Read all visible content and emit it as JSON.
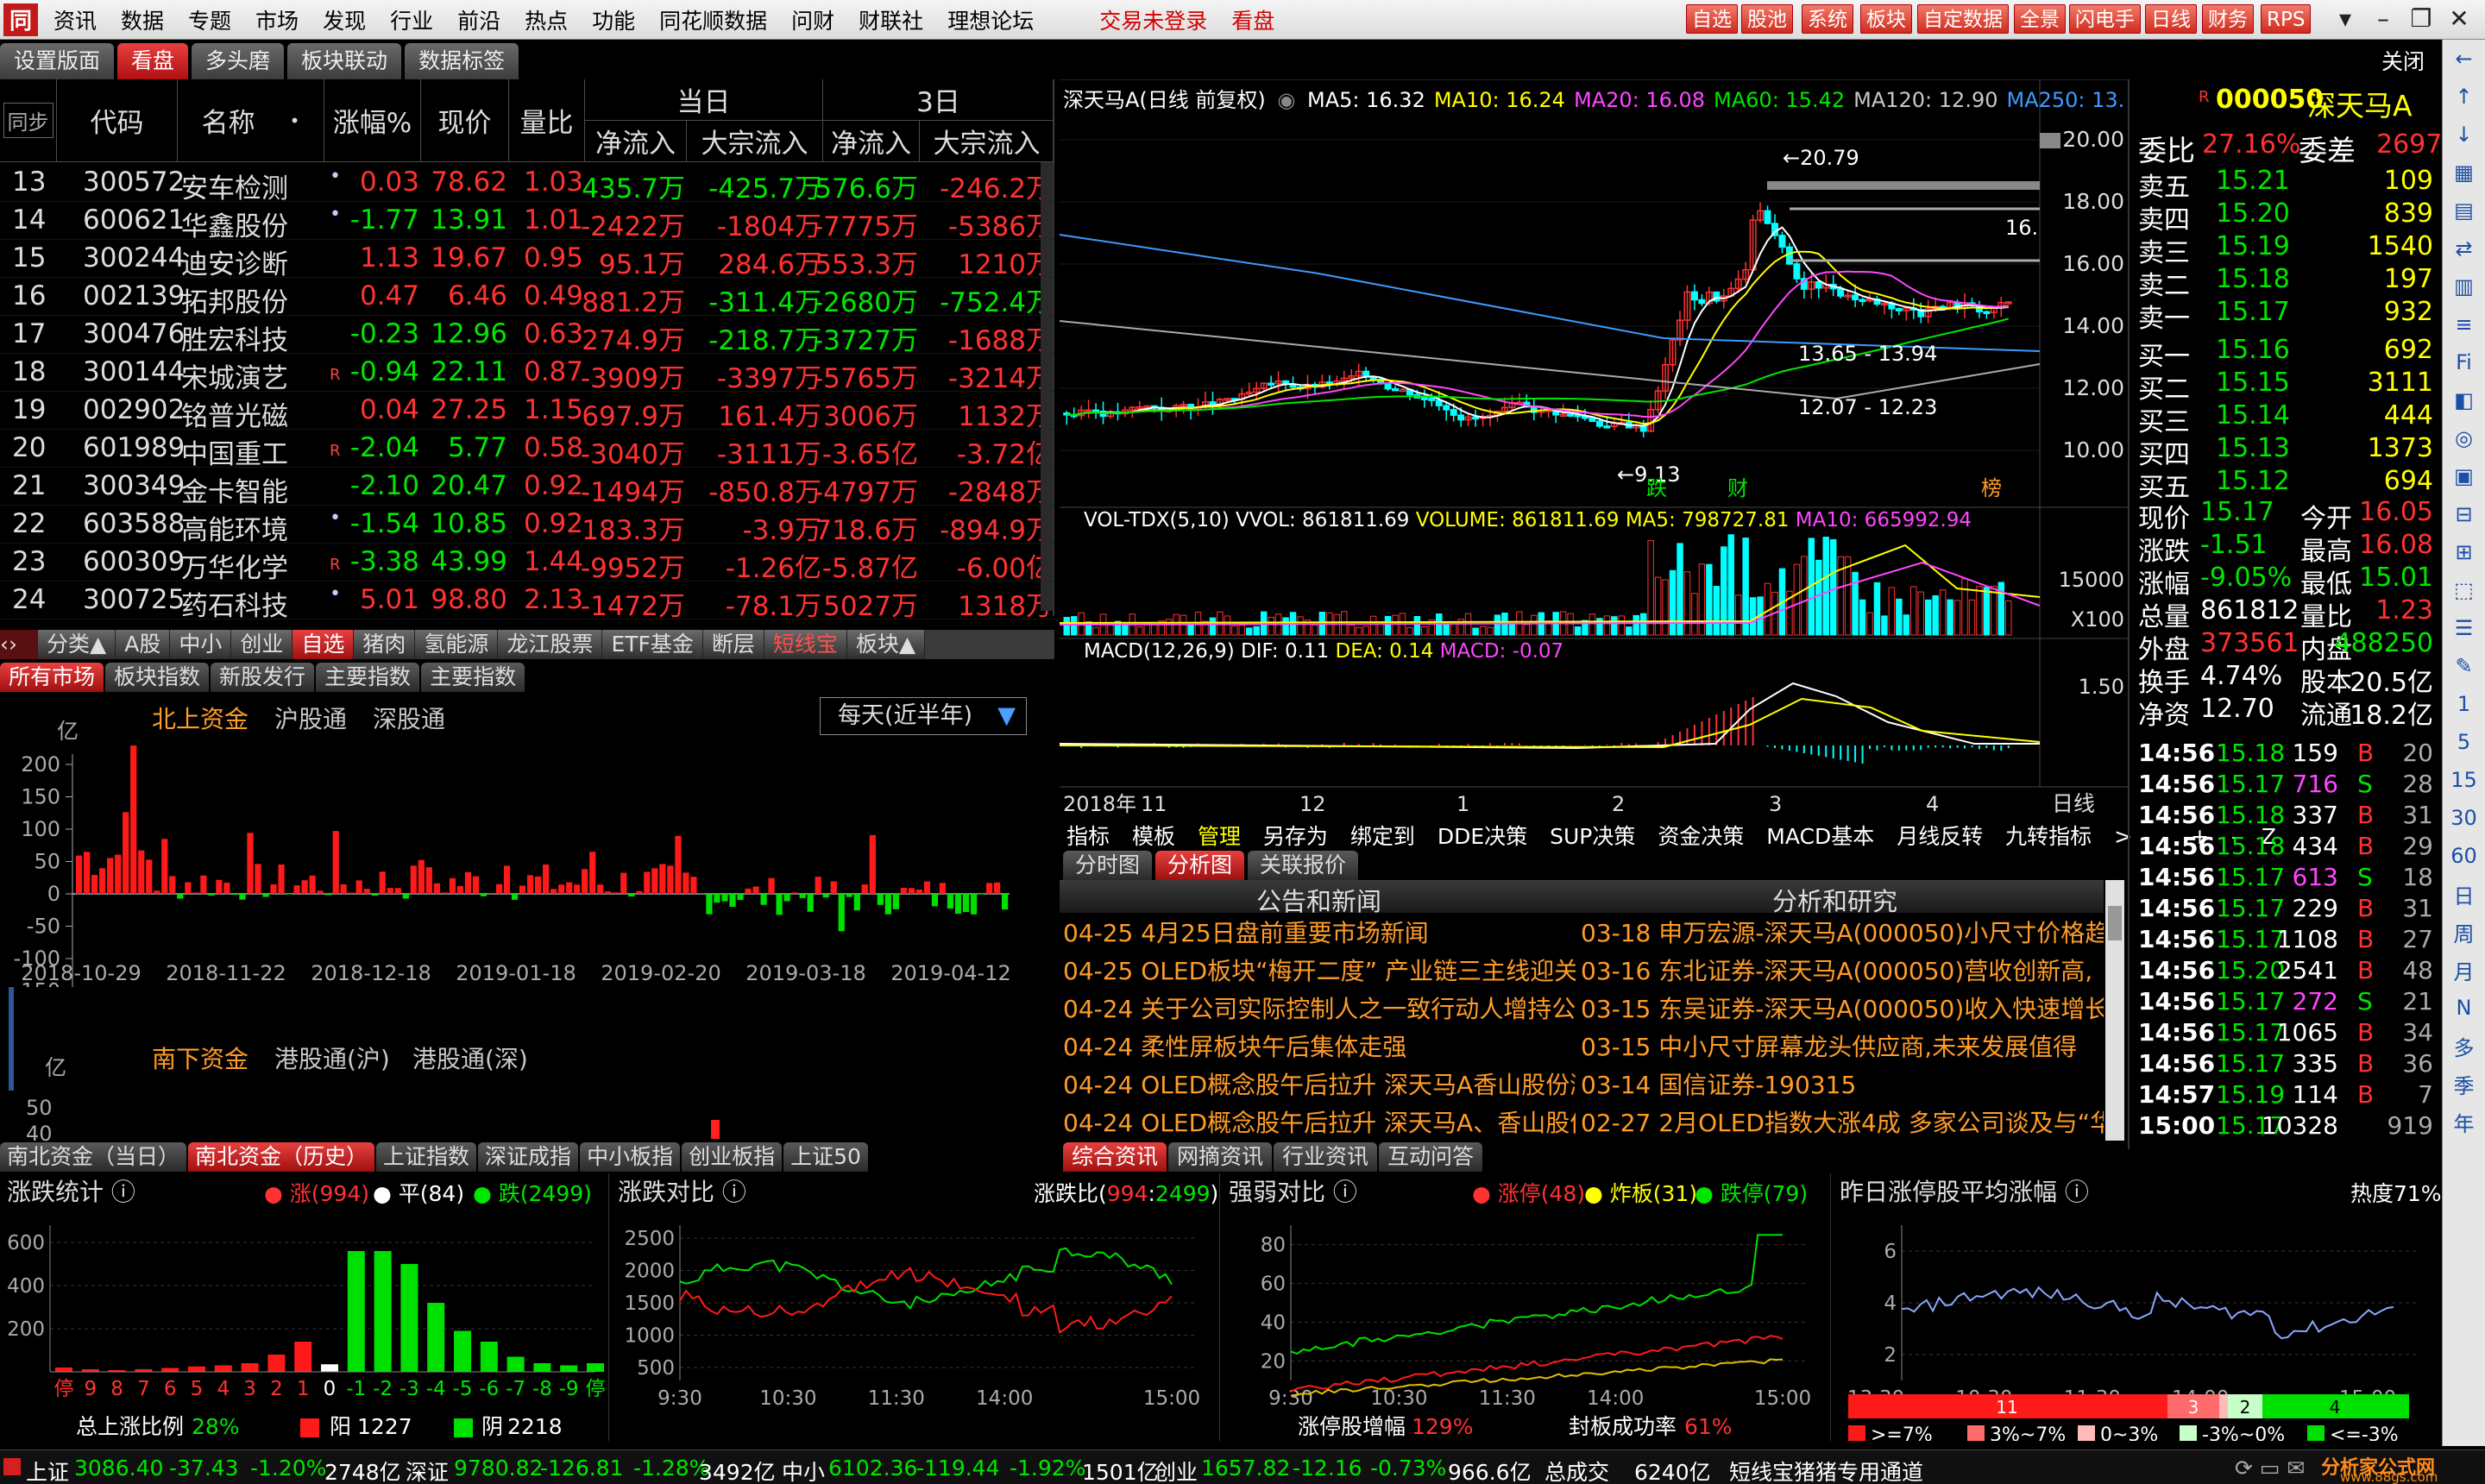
{
  "menubar": {
    "logo": "同",
    "items": [
      "资讯",
      "数据",
      "专题",
      "市场",
      "发现",
      "行业",
      "前沿",
      "热点",
      "功能",
      "同花顺数据",
      "问财",
      "财联社",
      "理想论坛"
    ],
    "login": "交易未登录",
    "kanpan": "看盘",
    "toolbuttons": [
      "自选",
      "股池",
      "系统",
      "板块",
      "自定数据",
      "全景",
      "闪电手",
      "日线",
      "财务",
      "RPS"
    ]
  },
  "tabs": [
    "设置版面",
    "看盘",
    "多头磨",
    "板块联动",
    "数据标签"
  ],
  "close": "关闭",
  "sidebar_icons": [
    "←",
    "↑",
    "↓",
    "▦",
    "▤",
    "⇄",
    "▥",
    "≡",
    "Fi",
    "◧",
    "◎",
    "▣",
    "⊟",
    "⊞",
    "⬚",
    "☰",
    "✎",
    "1",
    "5",
    "15",
    "30",
    "60",
    "日",
    "周",
    "月",
    "N",
    "多",
    "季",
    "年"
  ],
  "grid": {
    "headers": {
      "sync": "同步",
      "code": "代码",
      "name": "名称",
      "dot": "•",
      "pct": "涨幅%",
      "price": "现价",
      "lb": "量比",
      "today": "当日",
      "three": "3日",
      "inflow": "净流入",
      "bulk": "大宗流入",
      "inflow3": "净流入",
      "bulk3": "大宗流入"
    },
    "rows": [
      {
        "n": "13",
        "code": "300572",
        "name": "安车检测",
        "m": "•",
        "pct": "0.03",
        "price": "78.62",
        "lb": "1.03",
        "in": "435.7万",
        "bulk": "-425.7万",
        "in3": "576.6万",
        "bulk3": "-246.2万",
        "pr": "r",
        "ir": "g",
        "br": "g",
        "i3": "g",
        "b3": "r"
      },
      {
        "n": "14",
        "code": "600621",
        "name": "华鑫股份",
        "m": "•",
        "pct": "-1.77",
        "price": "13.91",
        "lb": "1.01",
        "in": "-2422万",
        "bulk": "-1804万",
        "in3": "-7775万",
        "bulk3": "-5386万",
        "pr": "g",
        "ir": "r",
        "br": "r",
        "i3": "r",
        "b3": "r"
      },
      {
        "n": "15",
        "code": "300244",
        "name": "迪安诊断",
        "m": "",
        "pct": "1.13",
        "price": "19.67",
        "lb": "0.95",
        "in": "95.1万",
        "bulk": "284.6万",
        "in3": "553.3万",
        "bulk3": "1210万",
        "pr": "r",
        "ir": "r",
        "br": "r",
        "i3": "r",
        "b3": "r"
      },
      {
        "n": "16",
        "code": "002139",
        "name": "拓邦股份",
        "m": "",
        "pct": "0.47",
        "price": "6.46",
        "lb": "0.49",
        "in": "881.2万",
        "bulk": "-311.4万",
        "in3": "-2680万",
        "bulk3": "-752.4万",
        "pr": "r",
        "ir": "r",
        "br": "g",
        "i3": "g",
        "b3": "g"
      },
      {
        "n": "17",
        "code": "300476",
        "name": "胜宏科技",
        "m": "",
        "pct": "-0.23",
        "price": "12.96",
        "lb": "0.63",
        "in": "274.9万",
        "bulk": "-218.7万",
        "in3": "-3727万",
        "bulk3": "-1688万",
        "pr": "g",
        "ir": "r",
        "br": "g",
        "i3": "g",
        "b3": "r"
      },
      {
        "n": "18",
        "code": "300144",
        "name": "宋城演艺",
        "m": "R",
        "pct": "-0.94",
        "price": "22.11",
        "lb": "0.87",
        "in": "-3909万",
        "bulk": "-3397万",
        "in3": "-5765万",
        "bulk3": "-3214万",
        "pr": "g",
        "ir": "r",
        "br": "r",
        "i3": "r",
        "b3": "r"
      },
      {
        "n": "19",
        "code": "002902",
        "name": "铭普光磁",
        "m": "",
        "pct": "0.04",
        "price": "27.25",
        "lb": "1.15",
        "in": "697.9万",
        "bulk": "161.4万",
        "in3": "3006万",
        "bulk3": "1132万",
        "pr": "r",
        "ir": "r",
        "br": "r",
        "i3": "r",
        "b3": "r"
      },
      {
        "n": "20",
        "code": "601989",
        "name": "中国重工",
        "m": "R",
        "pct": "-2.04",
        "price": "5.77",
        "lb": "0.58",
        "in": "-3040万",
        "bulk": "-3111万",
        "in3": "-3.65亿",
        "bulk3": "-3.72亿",
        "pr": "g",
        "ir": "r",
        "br": "r",
        "i3": "r",
        "b3": "r"
      },
      {
        "n": "21",
        "code": "300349",
        "name": "金卡智能",
        "m": "",
        "pct": "-2.10",
        "price": "20.47",
        "lb": "0.92",
        "in": "-1494万",
        "bulk": "-850.8万",
        "in3": "-4797万",
        "bulk3": "-2848万",
        "pr": "g",
        "ir": "r",
        "br": "r",
        "i3": "r",
        "b3": "r"
      },
      {
        "n": "22",
        "code": "603588",
        "name": "高能环境",
        "m": "•",
        "pct": "-1.54",
        "price": "10.85",
        "lb": "0.92",
        "in": "183.3万",
        "bulk": "-3.9万",
        "in3": "718.6万",
        "bulk3": "-894.9万",
        "pr": "g",
        "ir": "r",
        "br": "r",
        "i3": "r",
        "b3": "r"
      },
      {
        "n": "23",
        "code": "600309",
        "name": "万华化学",
        "m": "R",
        "pct": "-3.38",
        "price": "43.99",
        "lb": "1.44",
        "in": "-9952万",
        "bulk": "-1.26亿",
        "in3": "-5.87亿",
        "bulk3": "-6.00亿",
        "pr": "g",
        "ir": "r",
        "br": "r",
        "i3": "r",
        "b3": "r"
      },
      {
        "n": "24",
        "code": "300725",
        "name": "药石科技",
        "m": "•",
        "pct": "5.01",
        "price": "98.80",
        "lb": "2.13",
        "in": "-1472万",
        "bulk": "-78.1万",
        "in3": "5027万",
        "bulk3": "1318万",
        "pr": "r",
        "ir": "r",
        "br": "r",
        "i3": "r",
        "b3": "r"
      }
    ]
  },
  "cat1": [
    "分类▲",
    "A股",
    "中小",
    "创业",
    "自选",
    "猪肉",
    "氢能源",
    "龙江股票",
    "ETF基金",
    "断层",
    "短线宝",
    "板块▲"
  ],
  "cat2": [
    "所有市场",
    "板块指数",
    "新股发行",
    "主要指数",
    "主要指数"
  ],
  "northbound": {
    "unit": "亿",
    "tabs": [
      "北上资金",
      "沪股通",
      "深股通"
    ],
    "select": "每天(近半年)",
    "yticks": [
      "200",
      "150",
      "100",
      "50",
      "0",
      "-50",
      "-100",
      "-150"
    ],
    "dates": [
      "2018-10-29",
      "2018-11-22",
      "2018-12-18",
      "2019-01-18",
      "2019-02-20",
      "2019-03-18",
      "2019-04-12"
    ],
    "south_unit": "亿",
    "south_tabs": [
      "南下资金",
      "港股通(沪)",
      "港股通(深)"
    ],
    "south_ticks": [
      "50",
      "40"
    ]
  },
  "bar2": [
    "南北资金（当日）",
    "南北资金（历史）",
    "上证指数",
    "深证成指",
    "中小板指",
    "创业板指",
    "上证50"
  ],
  "kline": {
    "name": "深天马A",
    "period": "(日线 前复权)",
    "ma": [
      {
        "t": "MA5: 16.32",
        "c": "#ffffff"
      },
      {
        "t": "MA10: 16.24",
        "c": "#ffff00"
      },
      {
        "t": "MA20: 16.08",
        "c": "#ff46ff"
      },
      {
        "t": "MA60: 15.42",
        "c": "#00e600"
      },
      {
        "t": "MA120: 12.90",
        "c": "#c8c8c8"
      },
      {
        "t": "MA250: 13.",
        "c": "#3c9cff"
      }
    ],
    "yticks": [
      "20.00",
      "18.00",
      "16.00",
      "14.00",
      "12.00",
      "10.00"
    ],
    "high": "20.79",
    "low": "9.13",
    "range1": "13.65 - 13.94",
    "range2": "12.07 - 12.23",
    "side": "16.",
    "markers": [
      "跌",
      "财",
      "榜"
    ],
    "vol_title": "VOL-TDX(5,10)  VVOL: 861811.69",
    "vol_vals": [
      {
        "t": "VOLUME: 861811.69",
        "c": "#ffff00"
      },
      {
        "t": "MA5: 798727.81",
        "c": "#ffff00"
      },
      {
        "t": "MA10: 665992.94",
        "c": "#ff46ff"
      }
    ],
    "vol_tick": "15000",
    "vol_mult": "X100",
    "macd_title": "MACD(12,26,9)  DIF: 0.11",
    "macd_vals": [
      {
        "t": "DEA: 0.14",
        "c": "#ffff00"
      },
      {
        "t": "MACD: -0.07",
        "c": "#ff46ff"
      }
    ],
    "macd_tick": "1.50",
    "xlabels": [
      "2018年",
      "11",
      "12",
      "1",
      "2",
      "3",
      "4"
    ],
    "period_label": "日线"
  },
  "ctools": [
    "指标",
    "模板",
    "管理",
    "另存为",
    "绑定到",
    "DDE决策",
    "SUP决策",
    "资金决策",
    "MACD基本",
    "月线反转",
    "九转指标",
    ">",
    "+",
    "-",
    "Z"
  ],
  "atabs": [
    "分时图",
    "分析图",
    "关联报价"
  ],
  "news": {
    "h1": "公告和新闻",
    "h2": "分析和研究",
    "left": [
      [
        "04-25",
        "4月25日盘前重要市场新闻"
      ],
      [
        "04-25",
        "OLED板块“梅开二度” 产业链三主线迎关"
      ],
      [
        "04-24",
        "关于公司实际控制人之一致行动人增持公"
      ],
      [
        "04-24",
        "柔性屏板块午后集体走强"
      ],
      [
        "04-24",
        "OLED概念股午后拉升 深天马A香山股份涨"
      ],
      [
        "04-24",
        "OLED概念股午后拉升 深天马A、香山股份"
      ]
    ],
    "right": [
      [
        "03-18",
        "申万宏源-深天马A(000050)小尺寸价格趋"
      ],
      [
        "03-16",
        "东北证券-深天马A(000050)营收创新高,"
      ],
      [
        "03-15",
        "东吴证券-深天马A(000050)收入快速增长"
      ],
      [
        "03-15",
        "中小尺寸屏幕龙头供应商,未来发展值得"
      ],
      [
        "03-14",
        "国信证券-190315"
      ],
      [
        "02-27",
        "2月OLED指数大涨4成 多家公司谈及与“华"
      ]
    ]
  },
  "bar3": [
    "综合资讯",
    "网摘资讯",
    "行业资讯",
    "互动问答"
  ],
  "quote": {
    "r": "R",
    "code": "000050",
    "name": "深天马A",
    "wb": "委比",
    "wbv": "27.16%",
    "wc": "委差",
    "wcv": "2697",
    "asks": [
      [
        "卖五",
        "15.21",
        "109"
      ],
      [
        "卖四",
        "15.20",
        "839"
      ],
      [
        "卖三",
        "15.19",
        "1540"
      ],
      [
        "卖二",
        "15.18",
        "197"
      ],
      [
        "卖一",
        "15.17",
        "932"
      ]
    ],
    "bids": [
      [
        "买一",
        "15.16",
        "692"
      ],
      [
        "买二",
        "15.15",
        "3111"
      ],
      [
        "买三",
        "15.14",
        "444"
      ],
      [
        "买四",
        "15.13",
        "1373"
      ],
      [
        "买五",
        "15.12",
        "694"
      ]
    ],
    "stats": [
      [
        "现价",
        "15.17",
        "今开",
        "16.05"
      ],
      [
        "涨跌",
        "-1.51",
        "最高",
        "16.08"
      ],
      [
        "涨幅",
        "-9.05%",
        "最低",
        "15.01"
      ],
      [
        "总量",
        "861812",
        "量比",
        "1.23"
      ],
      [
        "外盘",
        "373561",
        "内盘",
        "488250"
      ],
      [
        "换手",
        "4.74%",
        "股本",
        "20.5亿"
      ],
      [
        "净资",
        "12.70",
        "流通",
        "18.2亿"
      ]
    ],
    "ticks": [
      [
        "14:56",
        "15.18",
        "159",
        "B",
        "20"
      ],
      [
        "14:56",
        "15.17",
        "716",
        "S",
        "28"
      ],
      [
        "14:56",
        "15.18",
        "337",
        "B",
        "31"
      ],
      [
        "14:56",
        "15.18",
        "434",
        "B",
        "29"
      ],
      [
        "14:56",
        "15.17",
        "613",
        "S",
        "18"
      ],
      [
        "14:56",
        "15.17",
        "229",
        "B",
        "31"
      ],
      [
        "14:56",
        "15.17",
        "1108",
        "B",
        "27"
      ],
      [
        "14:56",
        "15.20",
        "2541",
        "B",
        "48"
      ],
      [
        "14:56",
        "15.17",
        "272",
        "S",
        "21"
      ],
      [
        "14:56",
        "15.17",
        "1065",
        "B",
        "34"
      ],
      [
        "14:56",
        "15.17",
        "335",
        "B",
        "36"
      ],
      [
        "14:57",
        "15.19",
        "114",
        "B",
        "7"
      ],
      [
        "15:00",
        "15.17",
        "10328",
        "",
        "919"
      ]
    ]
  },
  "zdtj": {
    "title": "涨跌统计",
    "up": "涨(994)",
    "flat": "平(84)",
    "down": "跌(2499)",
    "yticks": [
      "600",
      "400",
      "200"
    ],
    "xl": [
      "停",
      "9",
      "8",
      "7",
      "6",
      "5",
      "4",
      "3",
      "2",
      "1",
      "0",
      "-1",
      "-2",
      "-3",
      "-4",
      "-5",
      "-6",
      "-7",
      "-8",
      "-9",
      "停"
    ],
    "ratio_label": "总上涨比例",
    "ratio": "28%",
    "yang_label": "阳",
    "yang": "1227",
    "yin_label": "阴",
    "yin": "2218"
  },
  "zdbi": {
    "title": "涨跌对比",
    "label": "涨跌比(",
    "up": "994",
    "sep": ":",
    "down": "2499",
    "end": ")",
    "yticks": [
      "2500",
      "2000",
      "1500",
      "1000",
      "500"
    ],
    "xt": [
      "9:30",
      "10:30",
      "11:30",
      "14:00",
      "15:00"
    ]
  },
  "qrdb": {
    "title": "强弱对比",
    "zt": "涨停(48)",
    "zb": "炸板(31)",
    "dt": "跌停(79)",
    "yticks": [
      "80",
      "60",
      "40",
      "20"
    ],
    "xt": [
      "9:30",
      "10:30",
      "11:30",
      "14:00",
      "15:00"
    ],
    "l1": "涨停股增幅",
    "v1": "129%",
    "l2": "封板成功率",
    "v2": "61%"
  },
  "zrzt": {
    "title": "昨日涨停股平均涨幅",
    "heat": "热度71%",
    "yticks": [
      "6",
      "4",
      "2"
    ],
    "xt": [
      "13:30",
      "10:30",
      "11:30",
      "14:00",
      "15:00"
    ],
    "seg": [
      "11",
      "3",
      "2",
      "4"
    ],
    "legend": [
      ">=7%",
      "3%~7%",
      "0~3%",
      "-3%~0%",
      "<=-3%"
    ]
  },
  "status": {
    "sh": "上证",
    "shv": "3086.40",
    "shc": "-37.43",
    "shp": "-1.20%",
    "sha": "2748亿",
    "sz": "深证",
    "szv": "9780.82",
    "szc": "-126.81",
    "szp": "-1.28%",
    "sza": "3492亿",
    "zx": "中小",
    "zxv": "6102.36",
    "zxc": "-119.44",
    "zxp": "-1.92%",
    "zxa": "1501亿",
    "cy": "创业",
    "cyv": "1657.82",
    "cyc": "-12.16",
    "cyp": "-0.73%",
    "cya": "966.6亿",
    "tot": "总成交",
    "tota": "6240亿",
    "ch": "短线宝猪猪专用通道",
    "brand": "分析家公式网",
    "url": "www.88gs.com"
  }
}
